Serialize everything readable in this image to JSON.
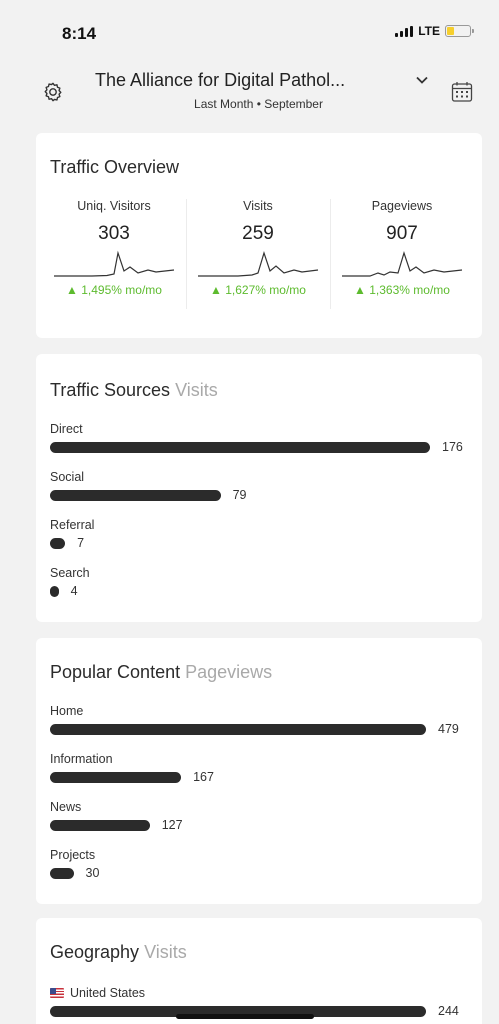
{
  "status_bar": {
    "time": "8:14",
    "network": "LTE",
    "battery_level": 0.3
  },
  "header": {
    "site_title": "The Alliance for Digital Pathol...",
    "period": "Last Month • September",
    "icons": [
      "gear-icon",
      "chevron-down-icon",
      "calendar-icon"
    ]
  },
  "traffic_overview": {
    "title": "Traffic Overview",
    "metrics": [
      {
        "label": "Uniq. Visitors",
        "value": "303",
        "change": "▲ 1,495% mo/mo"
      },
      {
        "label": "Visits",
        "value": "259",
        "change": "▲ 1,627% mo/mo"
      },
      {
        "label": "Pageviews",
        "value": "907",
        "change": "▲ 1,363% mo/mo"
      }
    ],
    "change_color": "#5dbb2e"
  },
  "traffic_sources": {
    "title": "Traffic Sources",
    "subtitle": "Visits",
    "items": [
      {
        "label": "Direct",
        "value": 176
      },
      {
        "label": "Social",
        "value": 79
      },
      {
        "label": "Referral",
        "value": 7
      },
      {
        "label": "Search",
        "value": 4
      }
    ]
  },
  "popular_content": {
    "title": "Popular Content",
    "subtitle": "Pageviews",
    "items": [
      {
        "label": "Home",
        "value": 479
      },
      {
        "label": "Information",
        "value": 167
      },
      {
        "label": "News",
        "value": 127
      },
      {
        "label": "Projects",
        "value": 30
      }
    ]
  },
  "geography": {
    "title": "Geography",
    "subtitle": "Visits",
    "items": [
      {
        "label": "United States",
        "value": 244
      }
    ]
  }
}
